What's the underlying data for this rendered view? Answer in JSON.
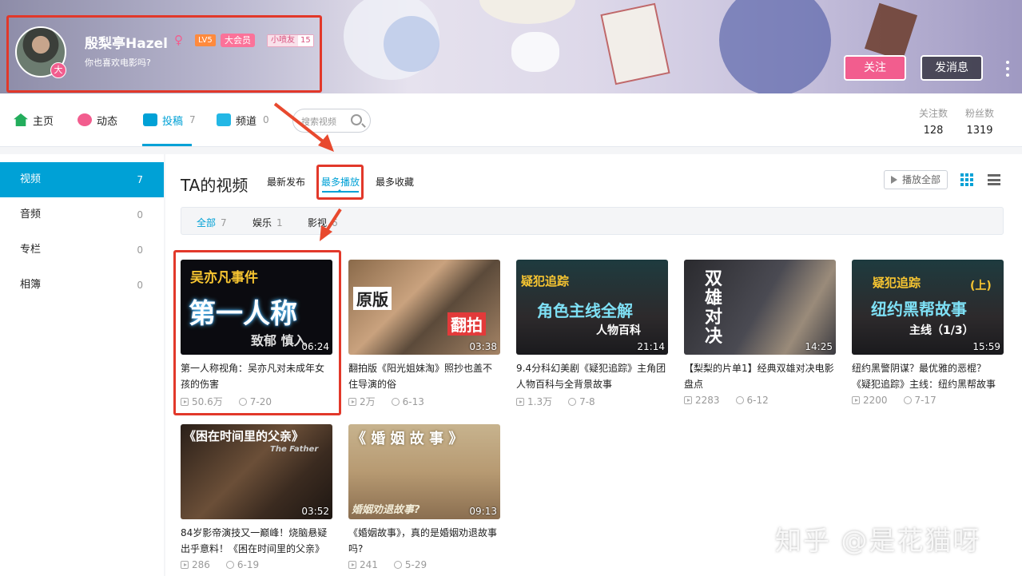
{
  "profile": {
    "name": "殷梨亭Hazel",
    "gender_icon": "♀",
    "level": "LV5",
    "vip": "大会员",
    "fan_badge_name": "小喷友",
    "fan_badge_level": "15",
    "avatar_badge": "大",
    "sign": "你也喜欢电影吗?",
    "follow_label": "关注",
    "message_label": "发消息"
  },
  "nav": {
    "items": [
      {
        "label": "主页",
        "count": ""
      },
      {
        "label": "动态",
        "count": ""
      },
      {
        "label": "投稿",
        "count": "7"
      },
      {
        "label": "频道",
        "count": "0"
      }
    ],
    "search_placeholder": "搜索视频",
    "following_label": "关注数",
    "following_value": "128",
    "followers_label": "粉丝数",
    "followers_value": "1319"
  },
  "sidebar": {
    "items": [
      {
        "label": "视频",
        "count": "7"
      },
      {
        "label": "音频",
        "count": "0"
      },
      {
        "label": "专栏",
        "count": "0"
      },
      {
        "label": "相簿",
        "count": "0"
      }
    ]
  },
  "section": {
    "title": "TA的视频",
    "sorts": [
      "最新发布",
      "最多播放",
      "最多收藏"
    ],
    "play_all": "播放全部",
    "filters": [
      {
        "label": "全部",
        "count": "7"
      },
      {
        "label": "娱乐",
        "count": "1"
      },
      {
        "label": "影视",
        "count": "6"
      }
    ]
  },
  "videos": [
    {
      "title": "第一人称视角：吴亦凡对未成年女孩的伤害",
      "duration": "06:24",
      "views": "50.6万",
      "date": "7-20",
      "thumb_text": [
        "吴亦凡事件",
        "第一人称",
        "致郁 慎入"
      ]
    },
    {
      "title": "翻拍版《阳光姐妹淘》照抄也盖不住导演的俗",
      "duration": "03:38",
      "views": "2万",
      "date": "6-13",
      "thumb_text": [
        "原版",
        "翻拍"
      ]
    },
    {
      "title": "9.4分科幻美剧《疑犯追踪》主角团人物百科与全背景故事",
      "duration": "21:14",
      "views": "1.3万",
      "date": "7-8",
      "thumb_text": [
        "疑犯追踪",
        "角色主线全解",
        "人物百科"
      ]
    },
    {
      "title": "【梨梨的片单1】经典双雄对决电影盘点",
      "duration": "14:25",
      "views": "2283",
      "date": "6-12",
      "thumb_text": [
        "双",
        "雄",
        "对",
        "决"
      ]
    },
    {
      "title": "纽约黑警阴谋？最优雅的恶棍？《疑犯追踪》主线：纽约黑帮故事",
      "duration": "15:59",
      "views": "2200",
      "date": "7-17",
      "thumb_text": [
        "疑犯追踪",
        "(上)",
        "纽约黑帮故事",
        "主线（1/3）"
      ]
    },
    {
      "title": "84岁影帝演技又一巅峰！烧脑悬疑出乎意料！《困在时间里的父亲》",
      "duration": "03:52",
      "views": "286",
      "date": "6-19",
      "thumb_text": [
        "《困在时间里的父亲》",
        "The Father"
      ]
    },
    {
      "title": "《婚姻故事》，真的是婚姻劝退故事吗?",
      "duration": "09:13",
      "views": "241",
      "date": "5-29",
      "thumb_text": [
        "《 婚 姻 故 事 》",
        "婚姻劝退故事?"
      ]
    }
  ],
  "watermark": "知乎 @是花猫呀",
  "colors": {
    "accent": "#00a1d6",
    "pink": "#f25d8e",
    "annotation_red": "#e2382a"
  }
}
